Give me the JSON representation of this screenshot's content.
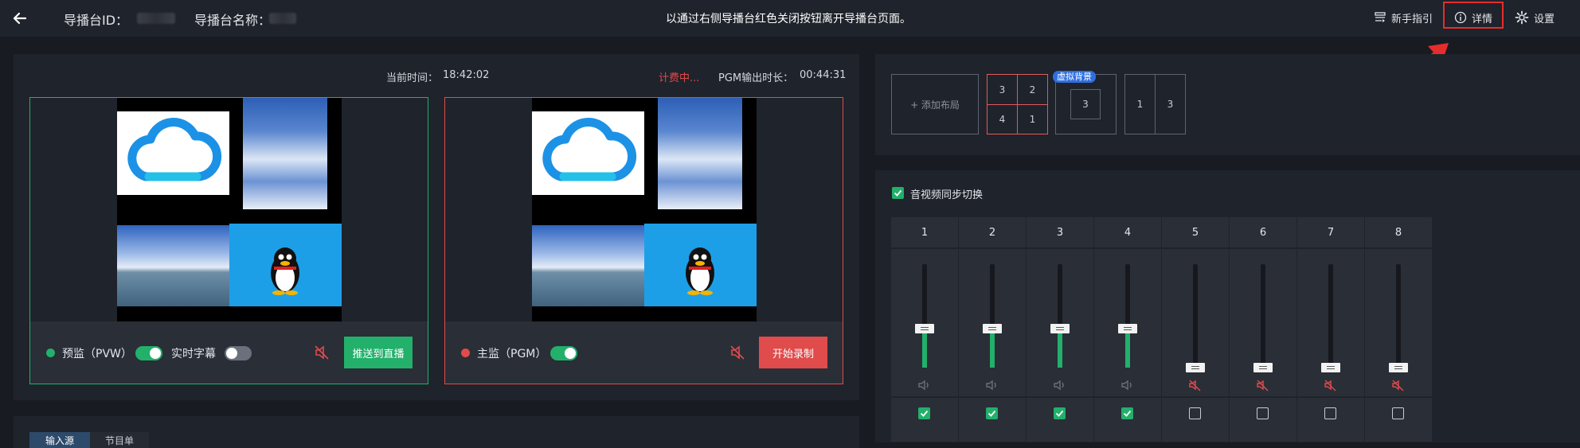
{
  "header": {
    "back_icon": "arrow-left-icon",
    "station_id_label": "导播台ID：",
    "station_name_label": "导播台名称：",
    "notice": "以通过右侧导播台红色关闭按钮离开导播台页面。",
    "guide_label": "新手指引",
    "detail_label": "详情",
    "settings_label": "设置"
  },
  "status": {
    "current_time_label": "当前时间：",
    "current_time": "18:42:02",
    "billing_label": "计费中...",
    "pgm_duration_label": "PGM输出时长：",
    "pgm_duration": "00:44:31"
  },
  "preview": {
    "label": "预监（PVW）",
    "subtitle_label": "实时字幕",
    "push_button": "推送到直播",
    "live_toggle_on": true,
    "subtitle_toggle_on": false,
    "accent": "#22b06b"
  },
  "program": {
    "label": "主监（PGM）",
    "record_button": "开始录制",
    "toggle_on": true,
    "accent": "#e04b4b"
  },
  "layouts": {
    "add_label": "+ 添加布局",
    "cards": [
      {
        "cells": [
          "3",
          "2",
          "4",
          "1"
        ],
        "active": true
      },
      {
        "badge": "虚拟背景",
        "cells": [
          "3"
        ],
        "active": false
      },
      {
        "cells": [
          "1",
          "3"
        ],
        "active": false
      }
    ]
  },
  "audio": {
    "sync_label": "音视频同步切换",
    "sync_checked": true,
    "channels": [
      {
        "label": "1",
        "level": 0.38,
        "active": true,
        "muted": false,
        "checked": true
      },
      {
        "label": "2",
        "level": 0.38,
        "active": true,
        "muted": false,
        "checked": true
      },
      {
        "label": "3",
        "level": 0.38,
        "active": true,
        "muted": false,
        "checked": true
      },
      {
        "label": "4",
        "level": 0.38,
        "active": true,
        "muted": false,
        "checked": true
      },
      {
        "label": "5",
        "level": 0.0,
        "active": false,
        "muted": true,
        "checked": false
      },
      {
        "label": "6",
        "level": 0.0,
        "active": false,
        "muted": true,
        "checked": false
      },
      {
        "label": "7",
        "level": 0.0,
        "active": false,
        "muted": true,
        "checked": false
      },
      {
        "label": "8",
        "level": 0.0,
        "active": false,
        "muted": true,
        "checked": false
      }
    ]
  },
  "bottom_tabs": [
    "输入源",
    "节目单"
  ],
  "colors": {
    "bg": "#181b22",
    "panel": "#1f232b",
    "green": "#22b06b",
    "red": "#e04b4b",
    "highlight": "#e52d2d"
  }
}
